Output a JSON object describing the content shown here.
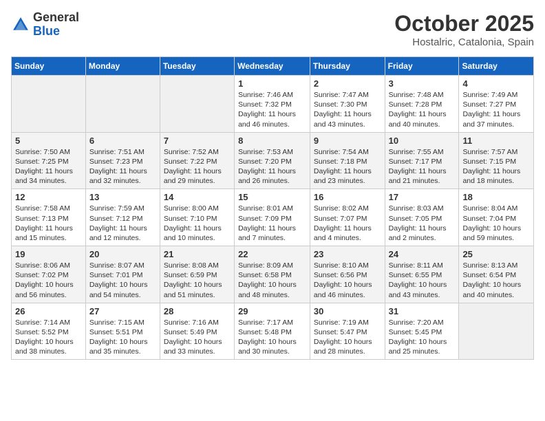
{
  "header": {
    "logo_line1": "General",
    "logo_line2": "Blue",
    "month": "October 2025",
    "location": "Hostalric, Catalonia, Spain"
  },
  "weekdays": [
    "Sunday",
    "Monday",
    "Tuesday",
    "Wednesday",
    "Thursday",
    "Friday",
    "Saturday"
  ],
  "weeks": [
    [
      {
        "day": "",
        "info": ""
      },
      {
        "day": "",
        "info": ""
      },
      {
        "day": "",
        "info": ""
      },
      {
        "day": "1",
        "info": "Sunrise: 7:46 AM\nSunset: 7:32 PM\nDaylight: 11 hours and 46 minutes."
      },
      {
        "day": "2",
        "info": "Sunrise: 7:47 AM\nSunset: 7:30 PM\nDaylight: 11 hours and 43 minutes."
      },
      {
        "day": "3",
        "info": "Sunrise: 7:48 AM\nSunset: 7:28 PM\nDaylight: 11 hours and 40 minutes."
      },
      {
        "day": "4",
        "info": "Sunrise: 7:49 AM\nSunset: 7:27 PM\nDaylight: 11 hours and 37 minutes."
      }
    ],
    [
      {
        "day": "5",
        "info": "Sunrise: 7:50 AM\nSunset: 7:25 PM\nDaylight: 11 hours and 34 minutes."
      },
      {
        "day": "6",
        "info": "Sunrise: 7:51 AM\nSunset: 7:23 PM\nDaylight: 11 hours and 32 minutes."
      },
      {
        "day": "7",
        "info": "Sunrise: 7:52 AM\nSunset: 7:22 PM\nDaylight: 11 hours and 29 minutes."
      },
      {
        "day": "8",
        "info": "Sunrise: 7:53 AM\nSunset: 7:20 PM\nDaylight: 11 hours and 26 minutes."
      },
      {
        "day": "9",
        "info": "Sunrise: 7:54 AM\nSunset: 7:18 PM\nDaylight: 11 hours and 23 minutes."
      },
      {
        "day": "10",
        "info": "Sunrise: 7:55 AM\nSunset: 7:17 PM\nDaylight: 11 hours and 21 minutes."
      },
      {
        "day": "11",
        "info": "Sunrise: 7:57 AM\nSunset: 7:15 PM\nDaylight: 11 hours and 18 minutes."
      }
    ],
    [
      {
        "day": "12",
        "info": "Sunrise: 7:58 AM\nSunset: 7:13 PM\nDaylight: 11 hours and 15 minutes."
      },
      {
        "day": "13",
        "info": "Sunrise: 7:59 AM\nSunset: 7:12 PM\nDaylight: 11 hours and 12 minutes."
      },
      {
        "day": "14",
        "info": "Sunrise: 8:00 AM\nSunset: 7:10 PM\nDaylight: 11 hours and 10 minutes."
      },
      {
        "day": "15",
        "info": "Sunrise: 8:01 AM\nSunset: 7:09 PM\nDaylight: 11 hours and 7 minutes."
      },
      {
        "day": "16",
        "info": "Sunrise: 8:02 AM\nSunset: 7:07 PM\nDaylight: 11 hours and 4 minutes."
      },
      {
        "day": "17",
        "info": "Sunrise: 8:03 AM\nSunset: 7:05 PM\nDaylight: 11 hours and 2 minutes."
      },
      {
        "day": "18",
        "info": "Sunrise: 8:04 AM\nSunset: 7:04 PM\nDaylight: 10 hours and 59 minutes."
      }
    ],
    [
      {
        "day": "19",
        "info": "Sunrise: 8:06 AM\nSunset: 7:02 PM\nDaylight: 10 hours and 56 minutes."
      },
      {
        "day": "20",
        "info": "Sunrise: 8:07 AM\nSunset: 7:01 PM\nDaylight: 10 hours and 54 minutes."
      },
      {
        "day": "21",
        "info": "Sunrise: 8:08 AM\nSunset: 6:59 PM\nDaylight: 10 hours and 51 minutes."
      },
      {
        "day": "22",
        "info": "Sunrise: 8:09 AM\nSunset: 6:58 PM\nDaylight: 10 hours and 48 minutes."
      },
      {
        "day": "23",
        "info": "Sunrise: 8:10 AM\nSunset: 6:56 PM\nDaylight: 10 hours and 46 minutes."
      },
      {
        "day": "24",
        "info": "Sunrise: 8:11 AM\nSunset: 6:55 PM\nDaylight: 10 hours and 43 minutes."
      },
      {
        "day": "25",
        "info": "Sunrise: 8:13 AM\nSunset: 6:54 PM\nDaylight: 10 hours and 40 minutes."
      }
    ],
    [
      {
        "day": "26",
        "info": "Sunrise: 7:14 AM\nSunset: 5:52 PM\nDaylight: 10 hours and 38 minutes."
      },
      {
        "day": "27",
        "info": "Sunrise: 7:15 AM\nSunset: 5:51 PM\nDaylight: 10 hours and 35 minutes."
      },
      {
        "day": "28",
        "info": "Sunrise: 7:16 AM\nSunset: 5:49 PM\nDaylight: 10 hours and 33 minutes."
      },
      {
        "day": "29",
        "info": "Sunrise: 7:17 AM\nSunset: 5:48 PM\nDaylight: 10 hours and 30 minutes."
      },
      {
        "day": "30",
        "info": "Sunrise: 7:19 AM\nSunset: 5:47 PM\nDaylight: 10 hours and 28 minutes."
      },
      {
        "day": "31",
        "info": "Sunrise: 7:20 AM\nSunset: 5:45 PM\nDaylight: 10 hours and 25 minutes."
      },
      {
        "day": "",
        "info": ""
      }
    ]
  ]
}
